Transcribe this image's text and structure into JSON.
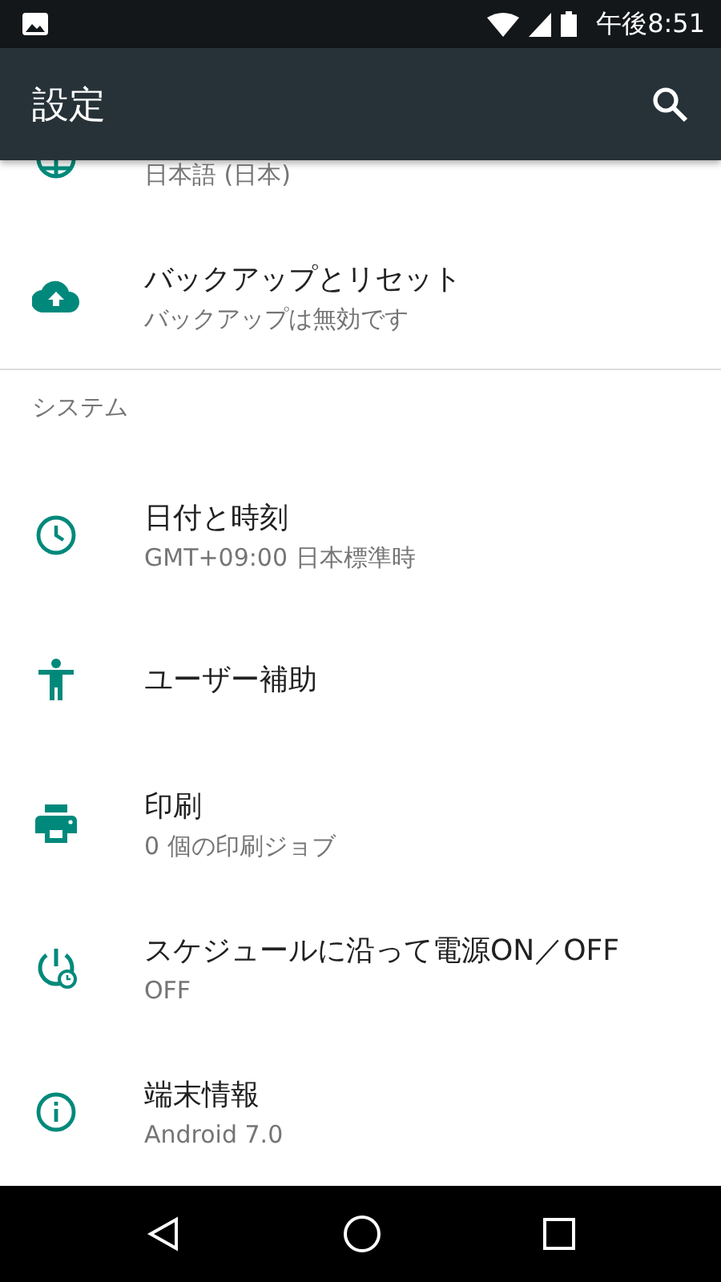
{
  "status_bar": {
    "time": "午後8:51"
  },
  "app_bar": {
    "title": "設定"
  },
  "sections": [
    {
      "items": [
        {
          "subtitle": "日本語 (日本)"
        },
        {
          "title": "バックアップとリセット",
          "subtitle": "バックアップは無効です"
        }
      ]
    },
    {
      "header": "システム",
      "items": [
        {
          "title": "日付と時刻",
          "subtitle": "GMT+09:00 日本標準時"
        },
        {
          "title": "ユーザー補助"
        },
        {
          "title": "印刷",
          "subtitle": "0 個の印刷ジョブ"
        },
        {
          "title": "スケジュールに沿って電源ON／OFF",
          "subtitle": "OFF"
        },
        {
          "title": "端末情報",
          "subtitle": "Android 7.0"
        }
      ]
    }
  ]
}
